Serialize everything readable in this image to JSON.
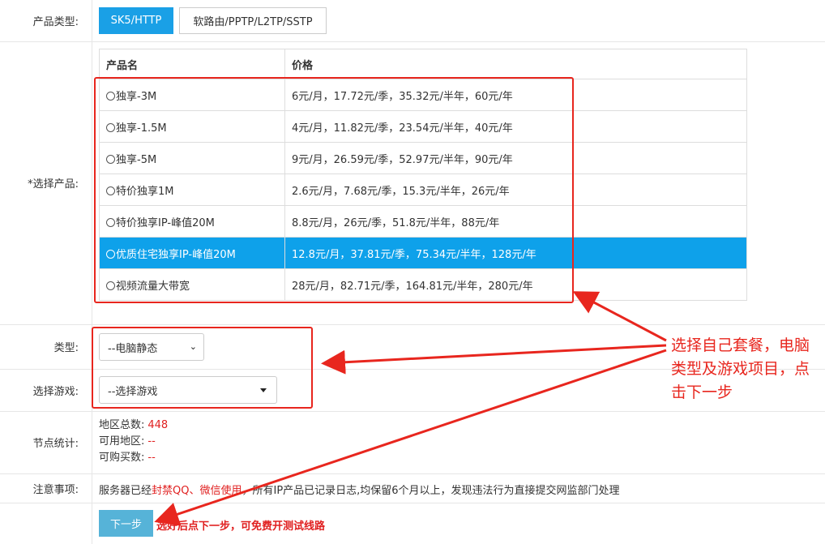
{
  "product_type": {
    "label": "产品类型:",
    "options": [
      "SK5/HTTP",
      "软路由/PPTP/L2TP/SSTP"
    ],
    "selected": "SK5/HTTP"
  },
  "select_product": {
    "label": "*选择产品:",
    "columns": [
      "产品名",
      "价格"
    ],
    "rows": [
      {
        "name": "独享-3M",
        "price": "6元/月，17.72元/季，35.32元/半年，60元/年"
      },
      {
        "name": "独享-1.5M",
        "price": "4元/月，11.82元/季，23.54元/半年，40元/年"
      },
      {
        "name": "独享-5M",
        "price": "9元/月，26.59元/季，52.97元/半年，90元/年"
      },
      {
        "name": "特价独享1M",
        "price": "2.6元/月，7.68元/季，15.3元/半年，26元/年"
      },
      {
        "name": "特价独享IP-峰值20M",
        "price": "8.8元/月，26元/季，51.8元/半年，88元/年"
      },
      {
        "name": "优质住宅独享IP-峰值20M",
        "price": "12.8元/月，37.81元/季，75.34元/半年，128元/年"
      },
      {
        "name": "视频流量大带宽",
        "price": "28元/月，82.71元/季，164.81元/半年，280元/年"
      }
    ],
    "selected_index": 5
  },
  "type_field": {
    "label": "类型:",
    "value": "--电脑静态"
  },
  "game_field": {
    "label": "选择游戏:",
    "value": "--选择游戏"
  },
  "node_stats": {
    "label": "节点统计:",
    "total_regions_label": "地区总数:",
    "total_regions_value": "448",
    "available_regions_label": "可用地区:",
    "available_regions_value": "--",
    "purchasable_label": "可购买数:",
    "purchasable_value": "--"
  },
  "notice": {
    "label": "注意事项:",
    "prefix": "服务器已经",
    "highlight": "封禁QQ、微信使用",
    "suffix": "，所有IP产品已记录日志,均保留6个月以上，发现违法行为直接提交网监部门处理"
  },
  "next": {
    "button_label": "下一步",
    "hint": "选好后点下一步，可免费开测试线路"
  },
  "annotation": {
    "text": "选择自己套餐，电脑类型及游戏项目，点击下一步"
  },
  "colors": {
    "accent": "#1aa0e6",
    "selected_row": "#0ea1ea",
    "red": "#e8261e"
  }
}
